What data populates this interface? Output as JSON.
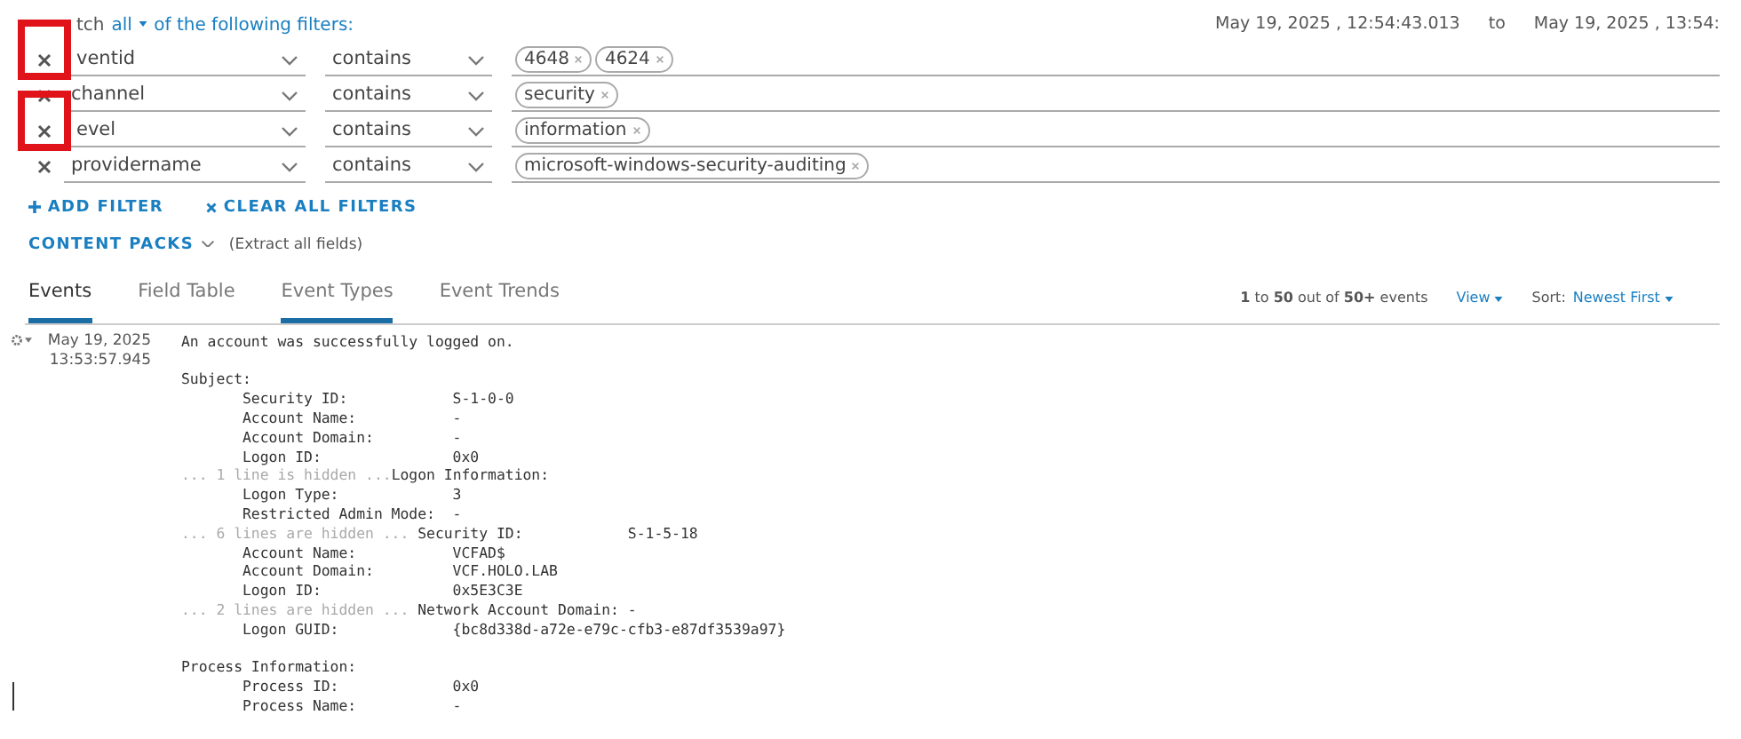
{
  "match": {
    "before": "tch",
    "mode": "all",
    "after": "of the following filters:"
  },
  "time_range": {
    "from": "May 19, 2025 , 12:54:43.013",
    "separator": "to",
    "to": "May 19, 2025 , 13:54:"
  },
  "filters": [
    {
      "highlighted": true,
      "field": "ventid",
      "operator": "contains",
      "values": [
        "4648",
        "4624"
      ]
    },
    {
      "highlighted": false,
      "field": "channel",
      "operator": "contains",
      "values": [
        "security"
      ]
    },
    {
      "highlighted": true,
      "field": "evel",
      "operator": "contains",
      "values": [
        "information"
      ]
    },
    {
      "highlighted": false,
      "field": "providername",
      "operator": "contains",
      "values": [
        "microsoft-windows-security-auditing"
      ]
    }
  ],
  "actions": [
    {
      "kind": "add",
      "label": "ADD FILTER"
    },
    {
      "kind": "clear",
      "label": "CLEAR ALL FILTERS"
    }
  ],
  "content_packs": {
    "label": "CONTENT PACKS",
    "note": "(Extract all fields)"
  },
  "tabs": [
    {
      "label": "Events",
      "selected": true,
      "underlined": true
    },
    {
      "label": "Field Table",
      "selected": false,
      "underlined": false
    },
    {
      "label": "Event Types",
      "selected": false,
      "underlined": true
    },
    {
      "label": "Event Trends",
      "selected": false,
      "underlined": false
    }
  ],
  "result_count": "**1** to **50** out of **50+** events",
  "view_menu": "View",
  "sort": {
    "label": "Sort:",
    "value": "Newest First"
  },
  "event": {
    "date": "May 19, 2025",
    "time": "13:53:57.945",
    "lines": [
      {
        "text": "An account was successfully logged on."
      },
      {
        "kind": "blank"
      },
      {
        "text": "Subject:"
      },
      {
        "text": "       Security ID:            S-1-0-0"
      },
      {
        "text": "       Account Name:           -"
      },
      {
        "text": "       Account Domain:         -"
      },
      {
        "text": "       Logon ID:               0x0"
      },
      {
        "note": "... 1 line is hidden ...",
        "text": "Logon Information:"
      },
      {
        "text": "       Logon Type:             3"
      },
      {
        "text": "       Restricted Admin Mode:  -"
      },
      {
        "note": "... 6 lines are hidden ...",
        "text": " Security ID:            S-1-5-18"
      },
      {
        "text": "       Account Name:           VCFAD$"
      },
      {
        "text": "       Account Domain:         VCF.HOLO.LAB"
      },
      {
        "text": "       Logon ID:               0x5E3C3E"
      },
      {
        "note": "... 2 lines are hidden ...",
        "text": " Network Account Domain: -"
      },
      {
        "text": "       Logon GUID:             {bc8d338d-a72e-e79c-cfb3-e87df3539a97}"
      },
      {
        "kind": "blank"
      },
      {
        "text": "Process Information:"
      },
      {
        "text": "       Process ID:             0x0"
      },
      {
        "text": "       Process Name:           -"
      }
    ]
  }
}
